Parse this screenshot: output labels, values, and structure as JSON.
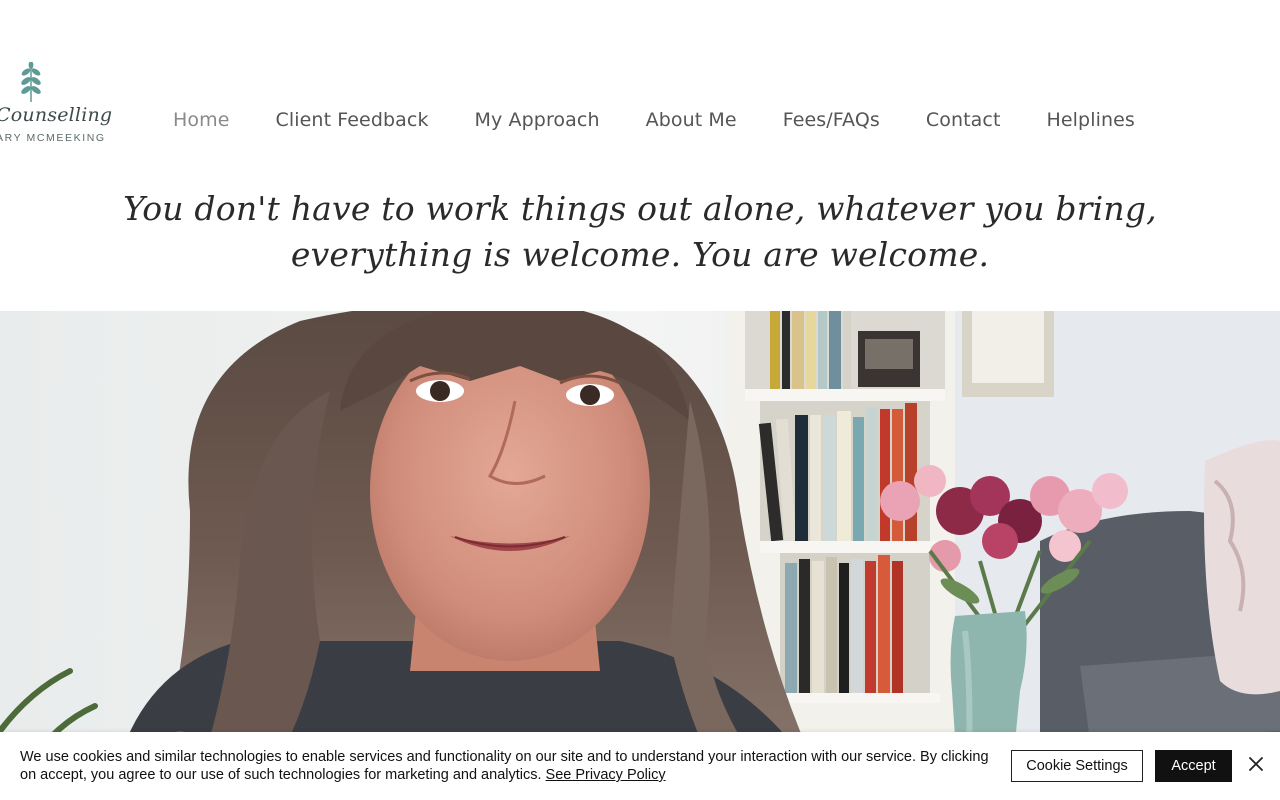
{
  "logo": {
    "script_text": "Counselling",
    "name_text": "ARY MCMEEKING",
    "leaf_color": "#5f9a96"
  },
  "nav": {
    "items": [
      {
        "label": "Home",
        "active": true
      },
      {
        "label": "Client Feedback",
        "active": false
      },
      {
        "label": "My Approach",
        "active": false
      },
      {
        "label": "About Me",
        "active": false
      },
      {
        "label": "Fees/FAQs",
        "active": false
      },
      {
        "label": "Contact",
        "active": false
      },
      {
        "label": "Helplines",
        "active": false
      }
    ]
  },
  "tagline": {
    "line1": "You don't have to work things out alone, whatever you bring,",
    "line2": "everything is welcome. You are welcome."
  },
  "cookie_banner": {
    "text": "We use cookies and similar technologies to enable services and functionality on our site and to understand your interaction with our service. By clicking on accept, you agree to our use of such technologies for marketing and analytics.",
    "link_text": "See Privacy Policy",
    "settings_label": "Cookie Settings",
    "accept_label": "Accept",
    "close_icon": "close-icon"
  },
  "colors": {
    "nav_text": "#555555",
    "nav_active": "#8a8a8a",
    "accept_bg": "#111111"
  }
}
